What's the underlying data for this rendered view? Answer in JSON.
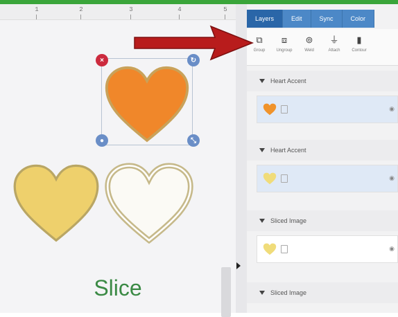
{
  "tabs": [
    "Layers",
    "Edit",
    "Sync",
    "Color"
  ],
  "tools": [
    {
      "icon": "group-icon",
      "label": "Group"
    },
    {
      "icon": "ungroup-icon",
      "label": "Ungroup"
    },
    {
      "icon": "weld-icon",
      "label": "Weld"
    },
    {
      "icon": "attach-icon",
      "label": "Attach"
    },
    {
      "icon": "contour-icon",
      "label": "Contour"
    }
  ],
  "layers": [
    {
      "title": "Heart Accent",
      "thumb_color": "#f0932b",
      "selected": true
    },
    {
      "title": "Heart Accent",
      "thumb_color": "#f0dc7a",
      "selected": true
    },
    {
      "title": "Sliced Image",
      "thumb_color": "#f0dc7a",
      "selected": false
    },
    {
      "title": "Sliced Image",
      "thumb_color": "#f0dc7a",
      "selected": false
    }
  ],
  "canvas": {
    "ruler_ticks": [
      "1",
      "2",
      "3",
      "4",
      "5"
    ],
    "label": "Slice"
  },
  "colors": {
    "orange_heart": "#f0872a",
    "yellow_heart": "#eed06c",
    "outline_heart": "#d6c99a",
    "arrow": "#b81c1c",
    "accent_blue": "#2a66a8",
    "top_bar": "#3aa53a"
  }
}
